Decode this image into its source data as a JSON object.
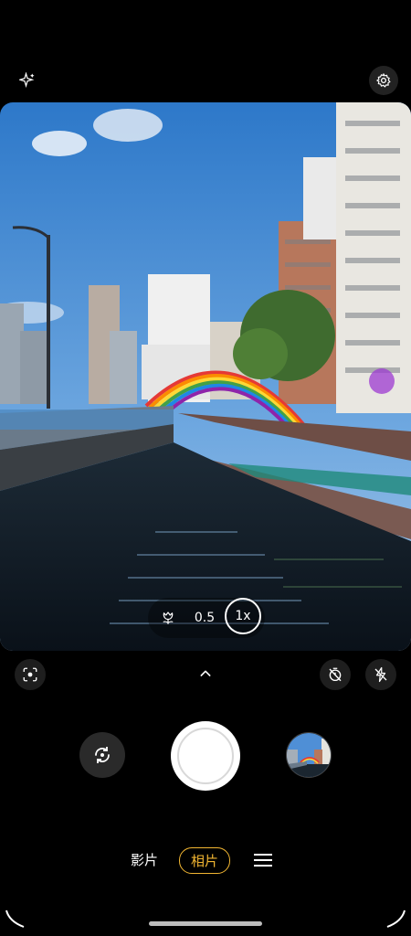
{
  "top_bar": {
    "sparkle_icon": "sparkle-icon",
    "settings_icon": "gear-icon"
  },
  "zoom": {
    "macro_icon": "tulip-icon",
    "options": [
      "0.5",
      "1x"
    ],
    "selected": "1x"
  },
  "controls_row": {
    "left_icon": "scan-focus-icon",
    "center_icon": "chevron-up-icon",
    "timer_icon": "timer-off-icon",
    "flash_icon": "flash-off-icon"
  },
  "capture_row": {
    "switch_camera_icon": "switch-camera-icon",
    "gallery_thumbnail": "gallery-thumbnail"
  },
  "modes": {
    "video_label": "影片",
    "photo_label": "相片",
    "more_icon": "menu-icon"
  }
}
